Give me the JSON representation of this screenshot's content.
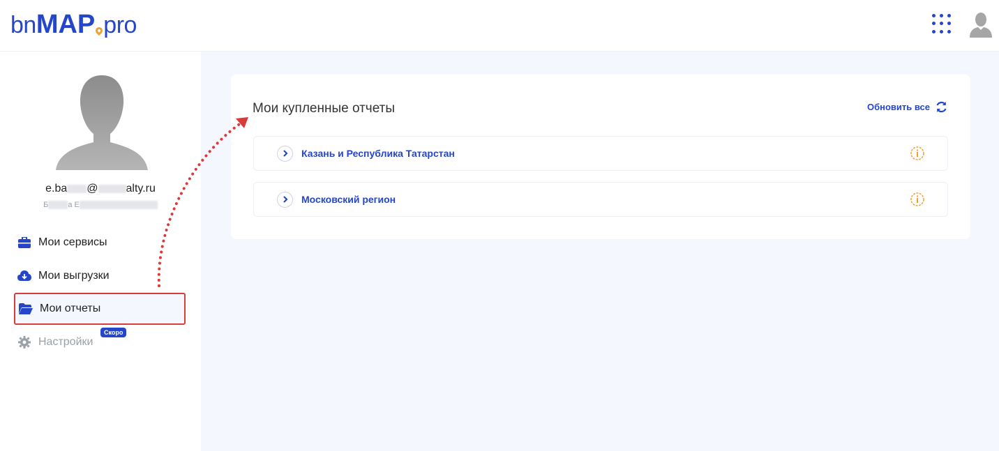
{
  "logo": {
    "part1": "bn",
    "part2": "MAP",
    "part3": "pro"
  },
  "profile": {
    "email_start": "e.ba",
    "email_mid": "@",
    "email_end": "alty.ru",
    "name_start": "Б",
    "name_mid": "а Е"
  },
  "nav": {
    "services": "Мои сервисы",
    "downloads": "Мои выгрузки",
    "reports": "Мои отчеты",
    "settings": "Настройки",
    "settings_badge": "Скоро"
  },
  "reports_card": {
    "title": "Мои купленные отчеты",
    "refresh_label": "Обновить все",
    "regions": [
      {
        "label": "Казань и Республика Татарстан"
      },
      {
        "label": "Московский регион"
      }
    ]
  },
  "colors": {
    "brand": "#2546c9",
    "accent": "#f0a030",
    "highlight": "#d93a3a"
  }
}
